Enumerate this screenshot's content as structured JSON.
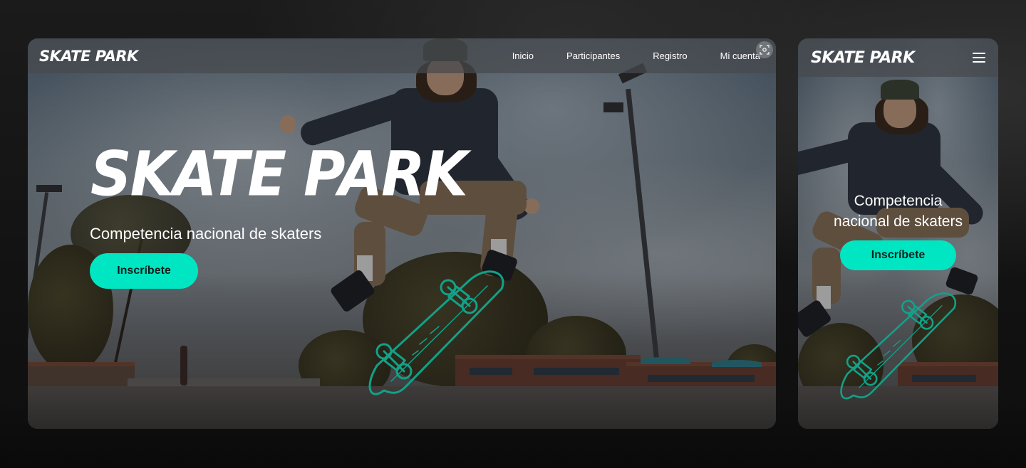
{
  "desktop": {
    "nav": {
      "logo": "SKATE PARK",
      "links": [
        "Inicio",
        "Participantes",
        "Registro",
        "Mi cuenta"
      ]
    },
    "hero": {
      "title": "SKATE PARK",
      "subtitle": "Competencia nacional de skaters",
      "cta": "Inscríbete"
    }
  },
  "mobile": {
    "nav": {
      "logo": "SKATE PARK",
      "menu_icon": "hamburger-icon"
    },
    "hero": {
      "subtitle_line1": "Competencia",
      "subtitle_line2": "nacional de skaters",
      "cta": "Inscríbete"
    }
  },
  "colors": {
    "accent": "#00e6c3",
    "text": "#ffffff",
    "nav_bg": "#464a4e",
    "page_bg": "#141414"
  }
}
